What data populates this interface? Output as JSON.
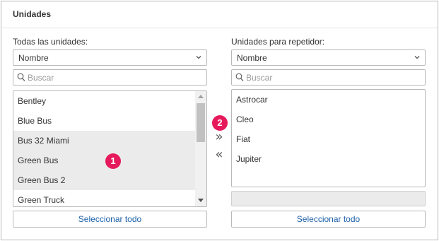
{
  "panel": {
    "title": "Unidades"
  },
  "left": {
    "label": "Todas las unidades:",
    "sort_select": "Nombre",
    "search_placeholder": "Buscar",
    "items": [
      {
        "label": "Bentley",
        "selected": false
      },
      {
        "label": "Blue Bus",
        "selected": false
      },
      {
        "label": "Bus 32 Miami",
        "selected": true
      },
      {
        "label": "Green Bus",
        "selected": true
      },
      {
        "label": "Green Bus 2",
        "selected": true
      },
      {
        "label": "Green Truck",
        "selected": false
      }
    ],
    "select_all": "Seleccionar todo"
  },
  "right": {
    "label": "Unidades para repetidor:",
    "sort_select": "Nombre",
    "search_placeholder": "Buscar",
    "items": [
      {
        "label": "Astrocar"
      },
      {
        "label": "Cleo"
      },
      {
        "label": "Fiat"
      },
      {
        "label": "Jupiter"
      }
    ],
    "select_all": "Seleccionar todo"
  },
  "move": {
    "add": "»",
    "remove": "«"
  },
  "badges": {
    "one": "1",
    "two": "2"
  },
  "colors": {
    "link": "#1a5fa8",
    "badge": "#e6195c",
    "selected_row": "#ebebeb",
    "border": "#b9b9b9"
  },
  "icons": {
    "dropdown": "chevron-down-icon",
    "search": "search-icon"
  }
}
